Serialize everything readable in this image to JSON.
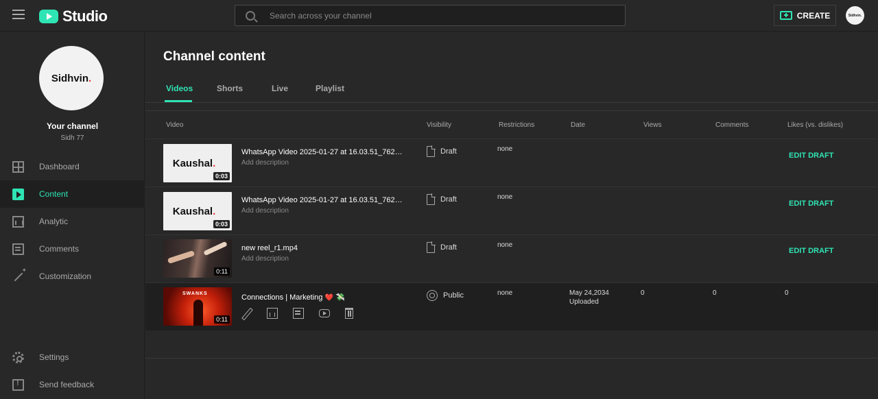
{
  "app": {
    "logo_text": "Studio",
    "search_placeholder": "Search across your channel",
    "create_label": "CREATE",
    "avatar_text": "Sidhvin.",
    "accent_color": "#2fe4b4"
  },
  "sidebar": {
    "avatar_name": "Sidhvin",
    "avatar_dot": ".",
    "your_channel": "Your channel",
    "handle": "Sidh 77",
    "items": [
      {
        "label": "Dashboard",
        "icon": "dashboard-icon"
      },
      {
        "label": "Content",
        "icon": "content-icon",
        "active": true
      },
      {
        "label": "Analytic",
        "icon": "analytics-icon"
      },
      {
        "label": "Comments",
        "icon": "comments-icon"
      },
      {
        "label": "Customization",
        "icon": "customization-icon"
      }
    ],
    "bottom_items": [
      {
        "label": "Settings",
        "icon": "gear-icon"
      },
      {
        "label": "Send feedback",
        "icon": "feedback-icon"
      }
    ]
  },
  "main": {
    "title": "Channel content",
    "tabs": [
      {
        "label": "Videos",
        "active": true
      },
      {
        "label": "Shorts"
      },
      {
        "label": "Live"
      },
      {
        "label": "Playlist"
      }
    ],
    "columns": [
      "Video",
      "Visibility",
      "Restrictions",
      "Date",
      "Views",
      "Comments",
      "Likes (vs. dislikes)"
    ],
    "rows": [
      {
        "thumb_text": "Kaushal",
        "thumb_dot": ".",
        "duration": "0:03",
        "title": "WhatsApp Video 2025-01-27 at 16.03.51_762d7...",
        "description": "Add description",
        "visibility": "Draft",
        "restrictions": "none",
        "action": "EDIT DRAFT"
      },
      {
        "thumb_text": "Kaushal",
        "thumb_dot": ".",
        "duration": "0:03",
        "title": "WhatsApp Video 2025-01-27 at 16.03.51_762d7...",
        "description": "Add description",
        "visibility": "Draft",
        "restrictions": "none",
        "action": "EDIT DRAFT"
      },
      {
        "duration": "0:11",
        "title": "new reel_r1.mp4",
        "description": "Add description",
        "visibility": "Draft",
        "restrictions": "none",
        "action": "EDIT DRAFT"
      },
      {
        "thumb_text": "SWANKS",
        "duration": "0:11",
        "title": "Connections | Marketing",
        "title_emoji": "❤️",
        "title_emoji2": "💸",
        "visibility": "Public",
        "restrictions": "none",
        "date": "May 24,2034",
        "date_status": "Uploaded",
        "views": "0",
        "comments": "0",
        "likes": "0"
      }
    ]
  }
}
